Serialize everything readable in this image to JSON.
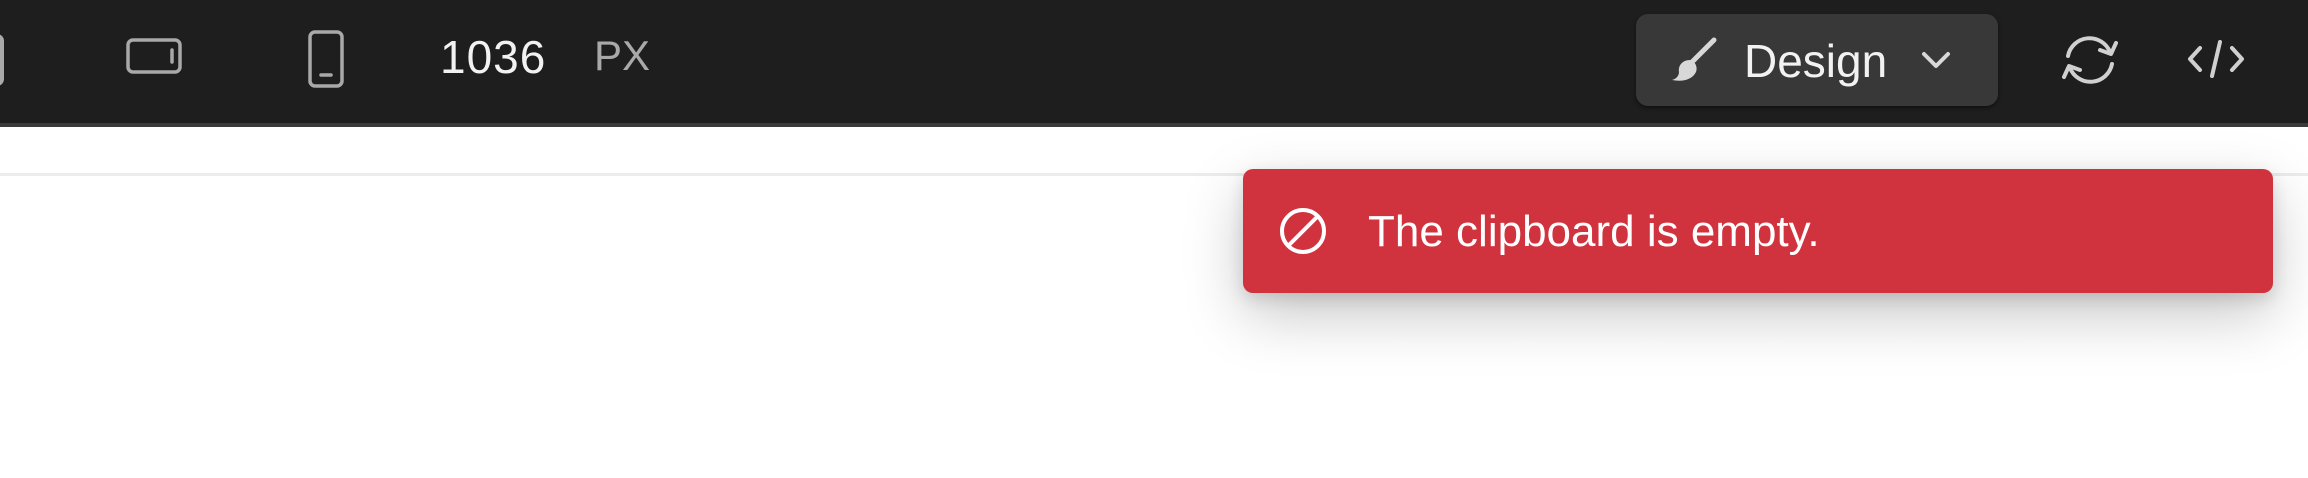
{
  "toolbar": {
    "device_icons": [
      "desktop-icon",
      "tablet-landscape-icon",
      "mobile-portrait-icon"
    ],
    "width_value": "1036",
    "width_unit": "PX",
    "mode_selector": {
      "label": "Design",
      "icon": "paintbrush-icon",
      "chevron": "chevron-down-icon"
    },
    "actions": [
      "sync-icon",
      "code-icon"
    ]
  },
  "toast": {
    "message": "The clipboard is empty.",
    "icon": "prohibited-icon",
    "color": "#d0323e"
  },
  "colors": {
    "toolbar_bg": "#1e1e1e",
    "button_bg": "#383838",
    "error": "#d0323e"
  }
}
